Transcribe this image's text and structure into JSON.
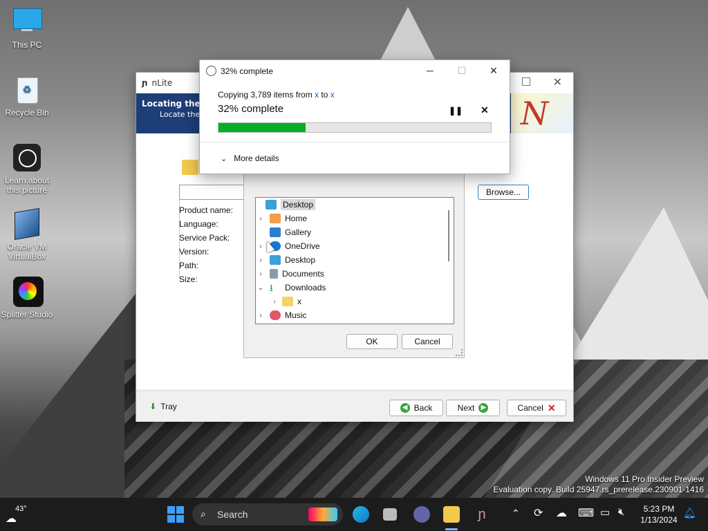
{
  "desktop": {
    "icons": [
      {
        "label": "This PC"
      },
      {
        "label": "Recycle Bin"
      },
      {
        "label": "Learn about this picture"
      },
      {
        "label": "Oracle VM VirtualBox"
      },
      {
        "label": "Splitter Studio"
      }
    ],
    "watermark_line1": "Windows 11 Pro Insider Preview",
    "watermark_line2": "Evaluation copy. Build 25947.rs_prerelease.230901-1416"
  },
  "nlite": {
    "title": "nLite",
    "banner_title": "Locating the W",
    "banner_subtitle": "Locate the W",
    "browse_label": "Browse...",
    "properties": [
      "Product name:",
      "Language:",
      "Service Pack:",
      "Version:",
      "Path:",
      "Size:"
    ],
    "tray_label": "Tray",
    "back_label": "Back",
    "next_label": "Next",
    "cancel_label": "Cancel"
  },
  "folder_dialog": {
    "tree": [
      {
        "label": "Desktop",
        "icon": "desktop-icon",
        "selected": true
      },
      {
        "label": "Home",
        "icon": "home-icon"
      },
      {
        "label": "Gallery",
        "icon": "gallery-icon"
      },
      {
        "label": "OneDrive",
        "icon": "cloud-icon"
      },
      {
        "label": "Desktop",
        "icon": "desktop-icon"
      },
      {
        "label": "Documents",
        "icon": "documents-icon"
      },
      {
        "label": "Downloads",
        "icon": "downloads-icon",
        "expanded": true
      },
      {
        "label": "x",
        "icon": "folder-icon"
      },
      {
        "label": "Music",
        "icon": "music-icon"
      }
    ],
    "ok_label": "OK",
    "cancel_label": "Cancel"
  },
  "progress_dialog": {
    "title": "32% complete",
    "copy_prefix": "Copying 3,789 items from ",
    "source": "x",
    "to_word": " to ",
    "destination": "x",
    "status": "32% complete",
    "progress": 0.32,
    "more_details": "More details"
  },
  "taskbar": {
    "weather_temp": "43°",
    "search_placeholder": "Search",
    "time": "5:23 PM",
    "date": "1/13/2024"
  },
  "colors": {
    "accent_green": "#06b025",
    "banner_blue": "#1e3e78",
    "link_blue": "#0066cc"
  }
}
